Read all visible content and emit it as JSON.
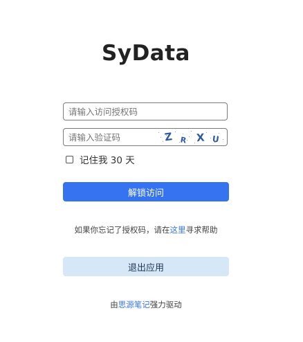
{
  "app": {
    "title": "SyData"
  },
  "form": {
    "code_placeholder": "请输入访问授权码",
    "captcha_placeholder": "请输入验证码",
    "captcha_chars": [
      "Z",
      "R",
      "X",
      "U"
    ],
    "remember_label": "记住我 30 天",
    "remember_checked": false,
    "unlock_label": "解锁访问"
  },
  "help": {
    "prefix": "如果你忘记了授权码，请在",
    "link": "这里",
    "suffix": "寻求帮助"
  },
  "exit": {
    "label": "退出应用"
  },
  "footer": {
    "prefix": "由",
    "link": "思源笔记",
    "suffix": "强力驱动"
  },
  "colors": {
    "primary": "#3573f0",
    "secondary_bg": "#d6e8f8",
    "link": "#3573f0",
    "captcha_ink": "#2f5aa0"
  }
}
